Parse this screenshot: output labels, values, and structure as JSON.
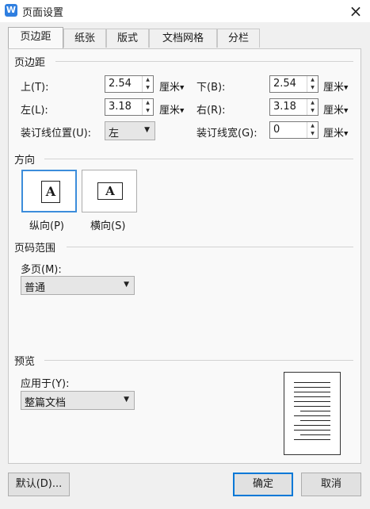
{
  "window": {
    "title": "页面设置",
    "close_glyph": "×",
    "app_icon_glyph": "W"
  },
  "tabs": [
    {
      "label": "页边距",
      "active": true
    },
    {
      "label": "纸张"
    },
    {
      "label": "版式"
    },
    {
      "label": "文档网格"
    },
    {
      "label": "分栏"
    }
  ],
  "margins": {
    "section_label": "页边距",
    "top": {
      "label": "上(T):",
      "value": "2.54",
      "unit": "厘米"
    },
    "bottom": {
      "label": "下(B):",
      "value": "2.54",
      "unit": "厘米"
    },
    "left": {
      "label": "左(L):",
      "value": "3.18",
      "unit": "厘米"
    },
    "right": {
      "label": "右(R):",
      "value": "3.18",
      "unit": "厘米"
    },
    "gutter_position": {
      "label": "装订线位置(U):",
      "value": "左"
    },
    "gutter_width": {
      "label": "装订线宽(G):",
      "value": "0",
      "unit": "厘米"
    }
  },
  "orientation": {
    "section_label": "方向",
    "portrait": {
      "label": "纵向(P)",
      "glyph": "A",
      "selected": true
    },
    "landscape": {
      "label": "横向(S)",
      "glyph": "A"
    }
  },
  "pages": {
    "section_label": "页码范围",
    "multiple_label": "多页(M):",
    "multiple_value": "普通"
  },
  "preview": {
    "section_label": "预览",
    "apply_label": "应用于(Y):",
    "apply_value": "整篇文档"
  },
  "buttons": {
    "default": "默认(D)...",
    "ok": "确定",
    "cancel": "取消"
  },
  "icons": {
    "spin_up": "▲",
    "spin_down": "▼",
    "dropdown": "▼"
  },
  "colors": {
    "accent": "#0078d7",
    "app_icon": "#2f7fe0",
    "selection": "#3c8ddb"
  }
}
